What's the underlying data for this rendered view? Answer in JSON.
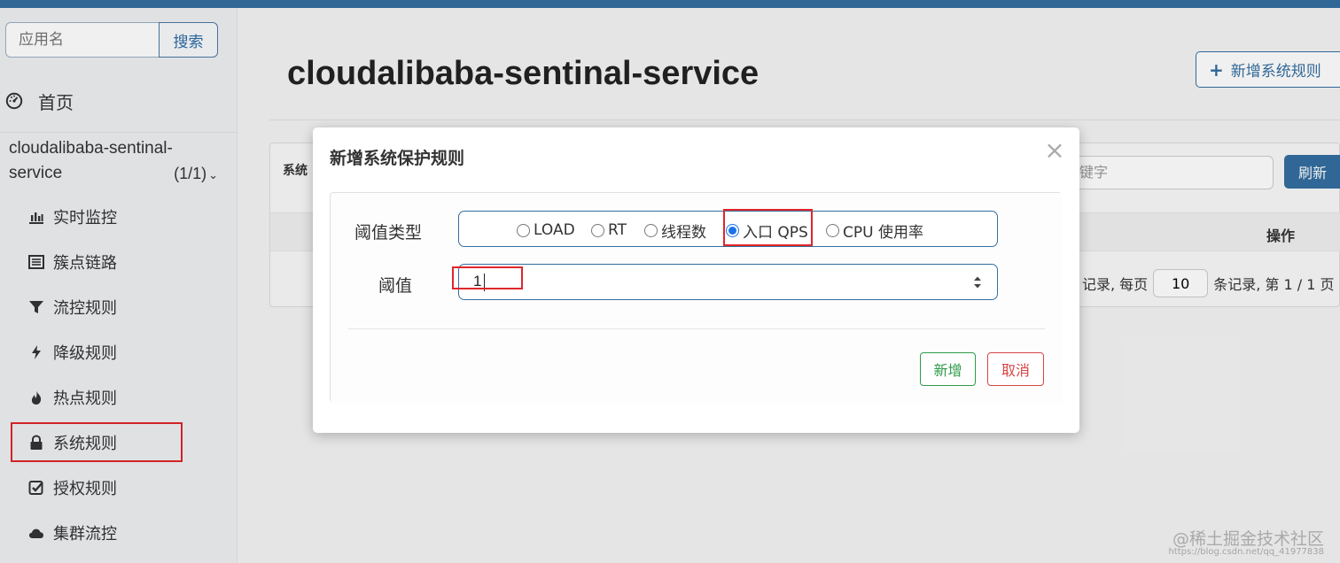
{
  "sidebar": {
    "search_placeholder": "应用名",
    "search_button": "搜索",
    "home_label": "首页",
    "app_name": "cloudalibaba-sentinal-service",
    "app_count": "(1/1)",
    "items": [
      {
        "label": "实时监控",
        "icon": "bar-chart-icon"
      },
      {
        "label": "簇点链路",
        "icon": "list-icon"
      },
      {
        "label": "流控规则",
        "icon": "filter-icon"
      },
      {
        "label": "降级规则",
        "icon": "lightning-icon"
      },
      {
        "label": "热点规则",
        "icon": "fire-icon"
      },
      {
        "label": "系统规则",
        "icon": "lock-icon",
        "highlighted": true
      },
      {
        "label": "授权规则",
        "icon": "check-square-icon"
      },
      {
        "label": "集群流控",
        "icon": "cloud-icon"
      }
    ]
  },
  "main": {
    "title": "cloudalibaba-sentinal-service",
    "add_button": "新增系统规则",
    "panel_label": "系统",
    "keyword_placeholder": "键字",
    "refresh_button": "刷新",
    "ops_header": "操作",
    "pager_prefix": "记录, 每页",
    "page_size": "10",
    "pager_suffix": "条记录, 第 1 / 1 页"
  },
  "modal": {
    "title": "新增系统保护规则",
    "threshold_type_label": "阈值类型",
    "options": [
      "LOAD",
      "RT",
      "线程数",
      "入口 QPS",
      "CPU 使用率"
    ],
    "selected_option": "入口 QPS",
    "threshold_label": "阈值",
    "threshold_value": "1",
    "add_button": "新增",
    "cancel_button": "取消",
    "close_icon": "×"
  },
  "watermark": {
    "text": "@稀土掘金技术社区",
    "url": "https://blog.csdn.net/qq_41977838"
  },
  "colors": {
    "primary": "#336ea0",
    "highlight": "#e0262b",
    "success": "#2e9a48",
    "danger": "#d64545"
  }
}
